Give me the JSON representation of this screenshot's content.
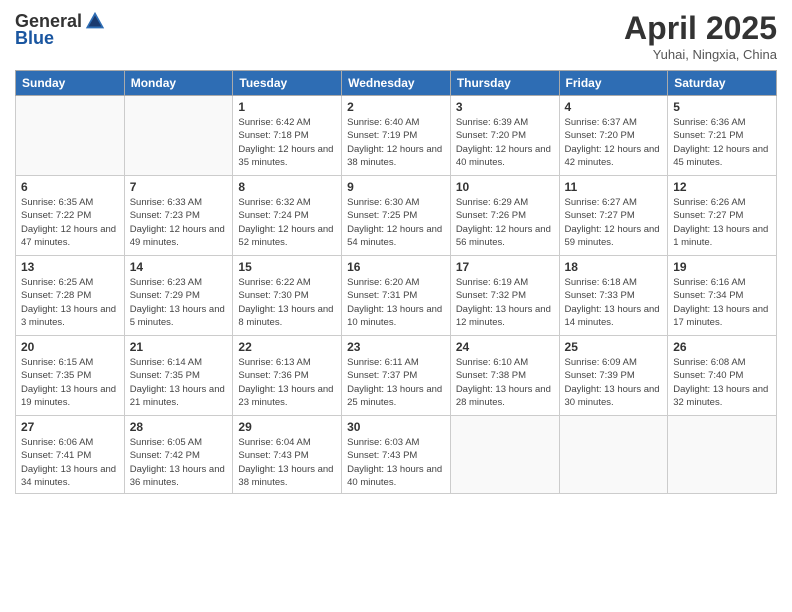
{
  "logo": {
    "general": "General",
    "blue": "Blue"
  },
  "title": "April 2025",
  "subtitle": "Yuhai, Ningxia, China",
  "days_of_week": [
    "Sunday",
    "Monday",
    "Tuesday",
    "Wednesday",
    "Thursday",
    "Friday",
    "Saturday"
  ],
  "weeks": [
    [
      {
        "day": "",
        "info": ""
      },
      {
        "day": "",
        "info": ""
      },
      {
        "day": "1",
        "info": "Sunrise: 6:42 AM\nSunset: 7:18 PM\nDaylight: 12 hours and 35 minutes."
      },
      {
        "day": "2",
        "info": "Sunrise: 6:40 AM\nSunset: 7:19 PM\nDaylight: 12 hours and 38 minutes."
      },
      {
        "day": "3",
        "info": "Sunrise: 6:39 AM\nSunset: 7:20 PM\nDaylight: 12 hours and 40 minutes."
      },
      {
        "day": "4",
        "info": "Sunrise: 6:37 AM\nSunset: 7:20 PM\nDaylight: 12 hours and 42 minutes."
      },
      {
        "day": "5",
        "info": "Sunrise: 6:36 AM\nSunset: 7:21 PM\nDaylight: 12 hours and 45 minutes."
      }
    ],
    [
      {
        "day": "6",
        "info": "Sunrise: 6:35 AM\nSunset: 7:22 PM\nDaylight: 12 hours and 47 minutes."
      },
      {
        "day": "7",
        "info": "Sunrise: 6:33 AM\nSunset: 7:23 PM\nDaylight: 12 hours and 49 minutes."
      },
      {
        "day": "8",
        "info": "Sunrise: 6:32 AM\nSunset: 7:24 PM\nDaylight: 12 hours and 52 minutes."
      },
      {
        "day": "9",
        "info": "Sunrise: 6:30 AM\nSunset: 7:25 PM\nDaylight: 12 hours and 54 minutes."
      },
      {
        "day": "10",
        "info": "Sunrise: 6:29 AM\nSunset: 7:26 PM\nDaylight: 12 hours and 56 minutes."
      },
      {
        "day": "11",
        "info": "Sunrise: 6:27 AM\nSunset: 7:27 PM\nDaylight: 12 hours and 59 minutes."
      },
      {
        "day": "12",
        "info": "Sunrise: 6:26 AM\nSunset: 7:27 PM\nDaylight: 13 hours and 1 minute."
      }
    ],
    [
      {
        "day": "13",
        "info": "Sunrise: 6:25 AM\nSunset: 7:28 PM\nDaylight: 13 hours and 3 minutes."
      },
      {
        "day": "14",
        "info": "Sunrise: 6:23 AM\nSunset: 7:29 PM\nDaylight: 13 hours and 5 minutes."
      },
      {
        "day": "15",
        "info": "Sunrise: 6:22 AM\nSunset: 7:30 PM\nDaylight: 13 hours and 8 minutes."
      },
      {
        "day": "16",
        "info": "Sunrise: 6:20 AM\nSunset: 7:31 PM\nDaylight: 13 hours and 10 minutes."
      },
      {
        "day": "17",
        "info": "Sunrise: 6:19 AM\nSunset: 7:32 PM\nDaylight: 13 hours and 12 minutes."
      },
      {
        "day": "18",
        "info": "Sunrise: 6:18 AM\nSunset: 7:33 PM\nDaylight: 13 hours and 14 minutes."
      },
      {
        "day": "19",
        "info": "Sunrise: 6:16 AM\nSunset: 7:34 PM\nDaylight: 13 hours and 17 minutes."
      }
    ],
    [
      {
        "day": "20",
        "info": "Sunrise: 6:15 AM\nSunset: 7:35 PM\nDaylight: 13 hours and 19 minutes."
      },
      {
        "day": "21",
        "info": "Sunrise: 6:14 AM\nSunset: 7:35 PM\nDaylight: 13 hours and 21 minutes."
      },
      {
        "day": "22",
        "info": "Sunrise: 6:13 AM\nSunset: 7:36 PM\nDaylight: 13 hours and 23 minutes."
      },
      {
        "day": "23",
        "info": "Sunrise: 6:11 AM\nSunset: 7:37 PM\nDaylight: 13 hours and 25 minutes."
      },
      {
        "day": "24",
        "info": "Sunrise: 6:10 AM\nSunset: 7:38 PM\nDaylight: 13 hours and 28 minutes."
      },
      {
        "day": "25",
        "info": "Sunrise: 6:09 AM\nSunset: 7:39 PM\nDaylight: 13 hours and 30 minutes."
      },
      {
        "day": "26",
        "info": "Sunrise: 6:08 AM\nSunset: 7:40 PM\nDaylight: 13 hours and 32 minutes."
      }
    ],
    [
      {
        "day": "27",
        "info": "Sunrise: 6:06 AM\nSunset: 7:41 PM\nDaylight: 13 hours and 34 minutes."
      },
      {
        "day": "28",
        "info": "Sunrise: 6:05 AM\nSunset: 7:42 PM\nDaylight: 13 hours and 36 minutes."
      },
      {
        "day": "29",
        "info": "Sunrise: 6:04 AM\nSunset: 7:43 PM\nDaylight: 13 hours and 38 minutes."
      },
      {
        "day": "30",
        "info": "Sunrise: 6:03 AM\nSunset: 7:43 PM\nDaylight: 13 hours and 40 minutes."
      },
      {
        "day": "",
        "info": ""
      },
      {
        "day": "",
        "info": ""
      },
      {
        "day": "",
        "info": ""
      }
    ]
  ]
}
